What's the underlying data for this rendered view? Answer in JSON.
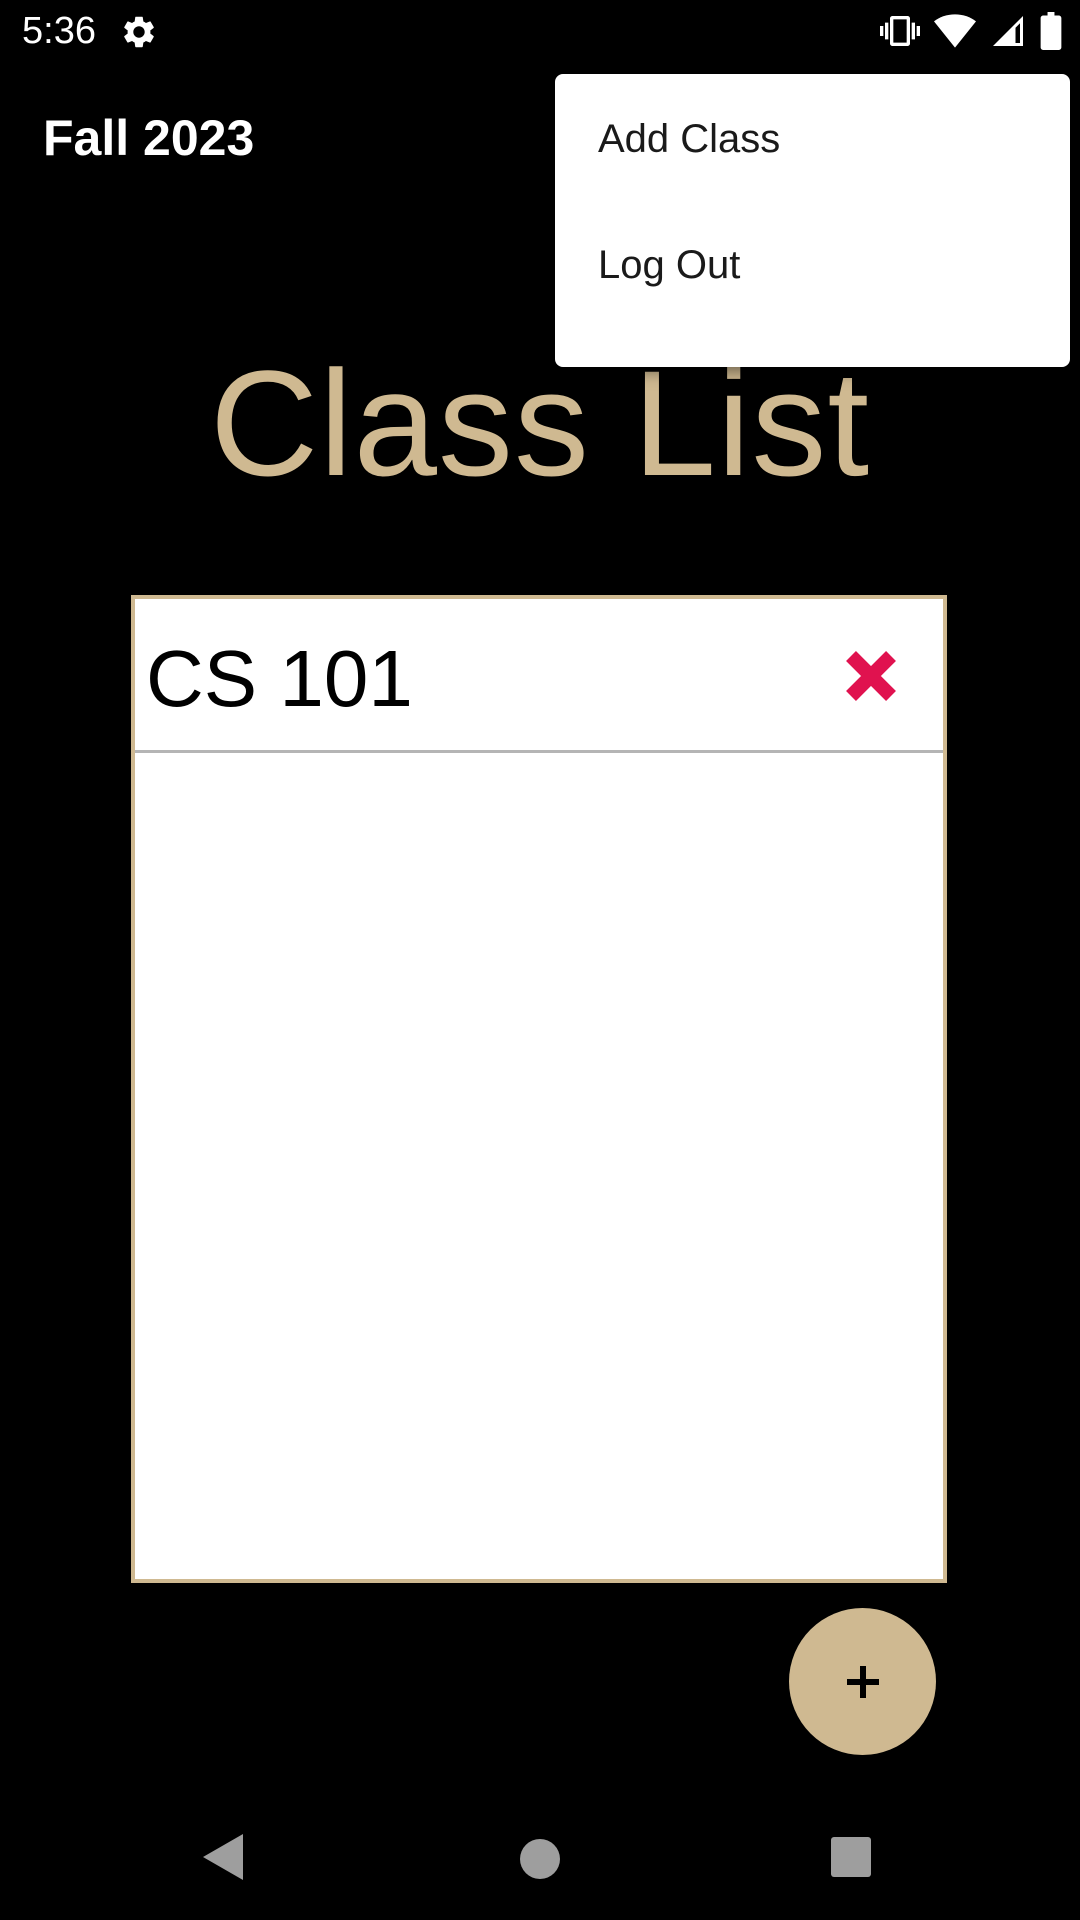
{
  "status_bar": {
    "time": "5:36",
    "icons": [
      "settings-gear-icon",
      "vibrate-icon",
      "wifi-icon",
      "signal-icon",
      "battery-icon"
    ]
  },
  "app_bar": {
    "title": "Fall 2023"
  },
  "main": {
    "heading": "Class List",
    "classes": [
      {
        "name": "CS 101",
        "delete_icon": "close-x-icon"
      }
    ]
  },
  "fab": {
    "icon": "plus-icon"
  },
  "overflow_menu": {
    "items": [
      {
        "label": "Add Class"
      },
      {
        "label": "Log Out"
      }
    ]
  },
  "nav_bar": {
    "icons": [
      "back-triangle-icon",
      "home-circle-icon",
      "recents-square-icon"
    ]
  },
  "colors": {
    "accent": "#cfb991",
    "background": "#000000",
    "delete": "#e0124f"
  }
}
